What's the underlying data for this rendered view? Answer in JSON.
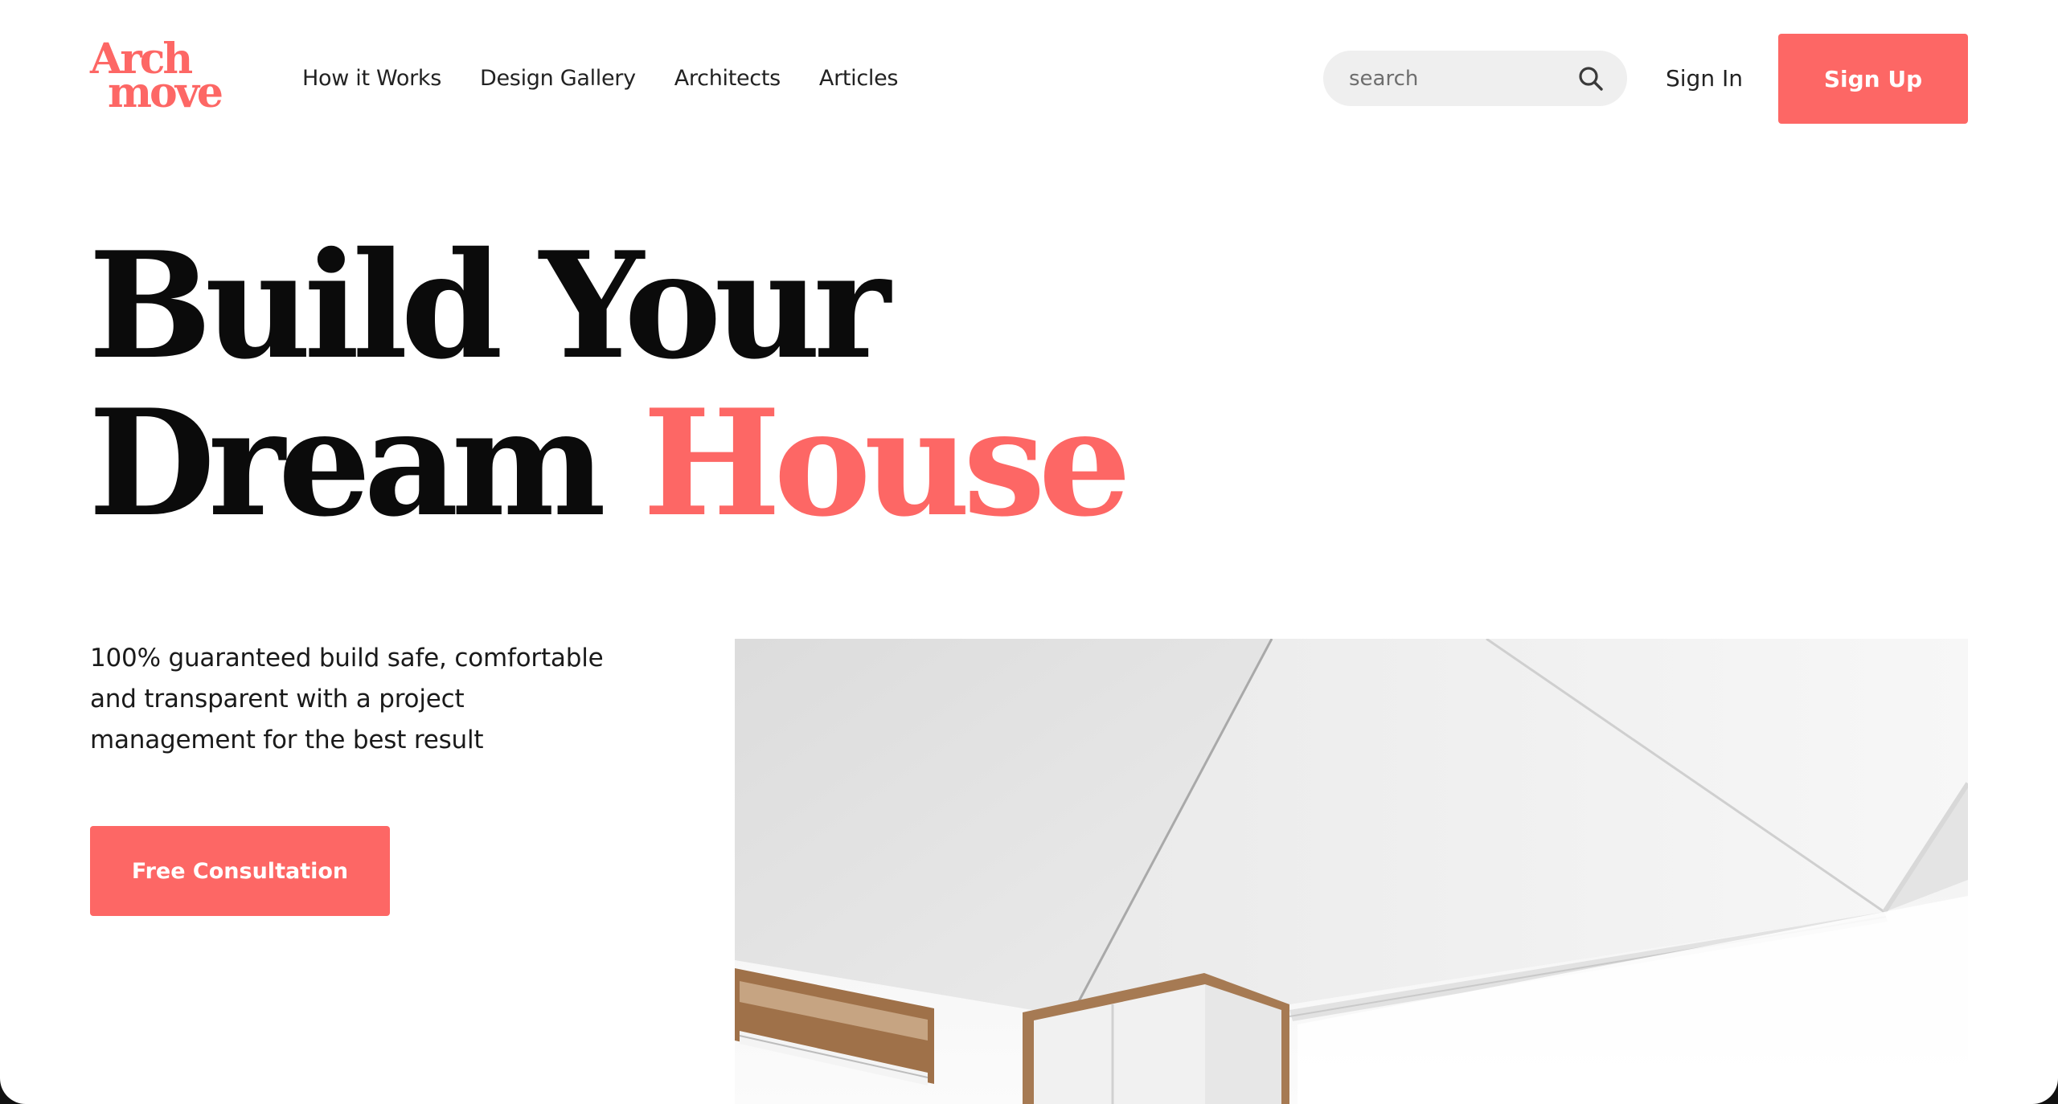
{
  "brand": {
    "logo_line1": "Arch",
    "logo_line2": "move",
    "accent_color": "#fd6765"
  },
  "nav": {
    "items": [
      {
        "label": "How it Works"
      },
      {
        "label": "Design Gallery"
      },
      {
        "label": "Architects"
      },
      {
        "label": "Articles"
      }
    ]
  },
  "search": {
    "placeholder": "search",
    "value": "",
    "icon": "search-icon"
  },
  "auth": {
    "signin_label": "Sign In",
    "signup_label": "Sign Up"
  },
  "hero": {
    "title_line1": "Build Your",
    "title_line2_plain": "Dream",
    "title_line2_accent": "House",
    "description": "100% guaranteed build safe, comfortable and transparent with a project management for the best result",
    "cta_label": "Free Consultation"
  }
}
